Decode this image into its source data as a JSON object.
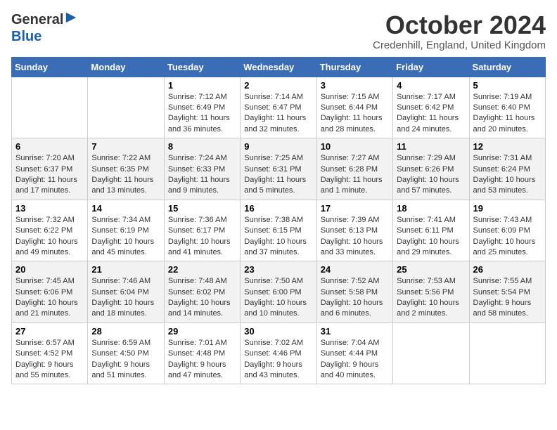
{
  "header": {
    "logo_line1": "General",
    "logo_line2": "Blue",
    "month_title": "October 2024",
    "location": "Credenhill, England, United Kingdom"
  },
  "days_of_week": [
    "Sunday",
    "Monday",
    "Tuesday",
    "Wednesday",
    "Thursday",
    "Friday",
    "Saturday"
  ],
  "weeks": [
    [
      {
        "day": "",
        "content": ""
      },
      {
        "day": "",
        "content": ""
      },
      {
        "day": "1",
        "content": "Sunrise: 7:12 AM\nSunset: 6:49 PM\nDaylight: 11 hours and 36 minutes."
      },
      {
        "day": "2",
        "content": "Sunrise: 7:14 AM\nSunset: 6:47 PM\nDaylight: 11 hours and 32 minutes."
      },
      {
        "day": "3",
        "content": "Sunrise: 7:15 AM\nSunset: 6:44 PM\nDaylight: 11 hours and 28 minutes."
      },
      {
        "day": "4",
        "content": "Sunrise: 7:17 AM\nSunset: 6:42 PM\nDaylight: 11 hours and 24 minutes."
      },
      {
        "day": "5",
        "content": "Sunrise: 7:19 AM\nSunset: 6:40 PM\nDaylight: 11 hours and 20 minutes."
      }
    ],
    [
      {
        "day": "6",
        "content": "Sunrise: 7:20 AM\nSunset: 6:37 PM\nDaylight: 11 hours and 17 minutes."
      },
      {
        "day": "7",
        "content": "Sunrise: 7:22 AM\nSunset: 6:35 PM\nDaylight: 11 hours and 13 minutes."
      },
      {
        "day": "8",
        "content": "Sunrise: 7:24 AM\nSunset: 6:33 PM\nDaylight: 11 hours and 9 minutes."
      },
      {
        "day": "9",
        "content": "Sunrise: 7:25 AM\nSunset: 6:31 PM\nDaylight: 11 hours and 5 minutes."
      },
      {
        "day": "10",
        "content": "Sunrise: 7:27 AM\nSunset: 6:28 PM\nDaylight: 11 hours and 1 minute."
      },
      {
        "day": "11",
        "content": "Sunrise: 7:29 AM\nSunset: 6:26 PM\nDaylight: 10 hours and 57 minutes."
      },
      {
        "day": "12",
        "content": "Sunrise: 7:31 AM\nSunset: 6:24 PM\nDaylight: 10 hours and 53 minutes."
      }
    ],
    [
      {
        "day": "13",
        "content": "Sunrise: 7:32 AM\nSunset: 6:22 PM\nDaylight: 10 hours and 49 minutes."
      },
      {
        "day": "14",
        "content": "Sunrise: 7:34 AM\nSunset: 6:19 PM\nDaylight: 10 hours and 45 minutes."
      },
      {
        "day": "15",
        "content": "Sunrise: 7:36 AM\nSunset: 6:17 PM\nDaylight: 10 hours and 41 minutes."
      },
      {
        "day": "16",
        "content": "Sunrise: 7:38 AM\nSunset: 6:15 PM\nDaylight: 10 hours and 37 minutes."
      },
      {
        "day": "17",
        "content": "Sunrise: 7:39 AM\nSunset: 6:13 PM\nDaylight: 10 hours and 33 minutes."
      },
      {
        "day": "18",
        "content": "Sunrise: 7:41 AM\nSunset: 6:11 PM\nDaylight: 10 hours and 29 minutes."
      },
      {
        "day": "19",
        "content": "Sunrise: 7:43 AM\nSunset: 6:09 PM\nDaylight: 10 hours and 25 minutes."
      }
    ],
    [
      {
        "day": "20",
        "content": "Sunrise: 7:45 AM\nSunset: 6:06 PM\nDaylight: 10 hours and 21 minutes."
      },
      {
        "day": "21",
        "content": "Sunrise: 7:46 AM\nSunset: 6:04 PM\nDaylight: 10 hours and 18 minutes."
      },
      {
        "day": "22",
        "content": "Sunrise: 7:48 AM\nSunset: 6:02 PM\nDaylight: 10 hours and 14 minutes."
      },
      {
        "day": "23",
        "content": "Sunrise: 7:50 AM\nSunset: 6:00 PM\nDaylight: 10 hours and 10 minutes."
      },
      {
        "day": "24",
        "content": "Sunrise: 7:52 AM\nSunset: 5:58 PM\nDaylight: 10 hours and 6 minutes."
      },
      {
        "day": "25",
        "content": "Sunrise: 7:53 AM\nSunset: 5:56 PM\nDaylight: 10 hours and 2 minutes."
      },
      {
        "day": "26",
        "content": "Sunrise: 7:55 AM\nSunset: 5:54 PM\nDaylight: 9 hours and 58 minutes."
      }
    ],
    [
      {
        "day": "27",
        "content": "Sunrise: 6:57 AM\nSunset: 4:52 PM\nDaylight: 9 hours and 55 minutes."
      },
      {
        "day": "28",
        "content": "Sunrise: 6:59 AM\nSunset: 4:50 PM\nDaylight: 9 hours and 51 minutes."
      },
      {
        "day": "29",
        "content": "Sunrise: 7:01 AM\nSunset: 4:48 PM\nDaylight: 9 hours and 47 minutes."
      },
      {
        "day": "30",
        "content": "Sunrise: 7:02 AM\nSunset: 4:46 PM\nDaylight: 9 hours and 43 minutes."
      },
      {
        "day": "31",
        "content": "Sunrise: 7:04 AM\nSunset: 4:44 PM\nDaylight: 9 hours and 40 minutes."
      },
      {
        "day": "",
        "content": ""
      },
      {
        "day": "",
        "content": ""
      }
    ]
  ]
}
